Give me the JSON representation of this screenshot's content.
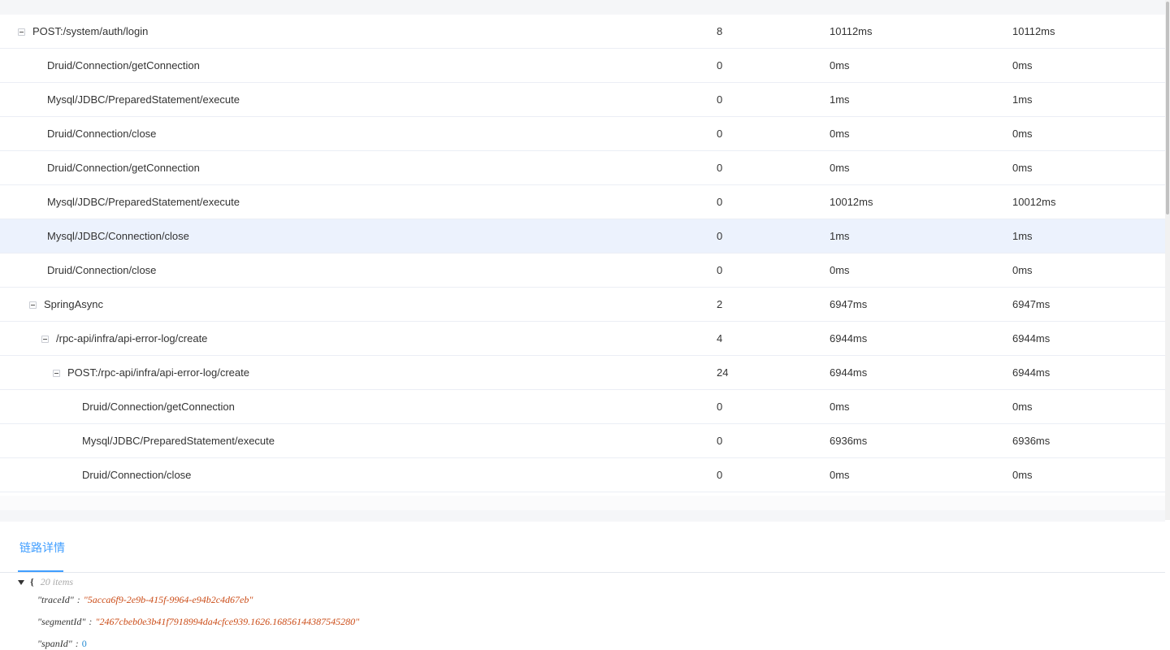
{
  "rows": [
    {
      "name": "POST:/system/auth/login",
      "count": "8",
      "duration": "10112ms",
      "self": "10112ms",
      "indent": 22,
      "toggle": true
    },
    {
      "name": "Druid/Connection/getConnection",
      "count": "0",
      "duration": "0ms",
      "self": "0ms",
      "indent": 58,
      "toggle": false
    },
    {
      "name": "Mysql/JDBC/PreparedStatement/execute",
      "count": "0",
      "duration": "1ms",
      "self": "1ms",
      "indent": 58,
      "toggle": false
    },
    {
      "name": "Druid/Connection/close",
      "count": "0",
      "duration": "0ms",
      "self": "0ms",
      "indent": 58,
      "toggle": false
    },
    {
      "name": "Druid/Connection/getConnection",
      "count": "0",
      "duration": "0ms",
      "self": "0ms",
      "indent": 58,
      "toggle": false
    },
    {
      "name": "Mysql/JDBC/PreparedStatement/execute",
      "count": "0",
      "duration": "10012ms",
      "self": "10012ms",
      "indent": 58,
      "toggle": false
    },
    {
      "name": "Mysql/JDBC/Connection/close",
      "count": "0",
      "duration": "1ms",
      "self": "1ms",
      "indent": 58,
      "toggle": false,
      "selected": true
    },
    {
      "name": "Druid/Connection/close",
      "count": "0",
      "duration": "0ms",
      "self": "0ms",
      "indent": 58,
      "toggle": false
    },
    {
      "name": "SpringAsync",
      "count": "2",
      "duration": "6947ms",
      "self": "6947ms",
      "indent": 36,
      "toggle": true
    },
    {
      "name": "/rpc-api/infra/api-error-log/create",
      "count": "4",
      "duration": "6944ms",
      "self": "6944ms",
      "indent": 51,
      "toggle": true
    },
    {
      "name": "POST:/rpc-api/infra/api-error-log/create",
      "count": "24",
      "duration": "6944ms",
      "self": "6944ms",
      "indent": 65,
      "toggle": true
    },
    {
      "name": "Druid/Connection/getConnection",
      "count": "0",
      "duration": "0ms",
      "self": "0ms",
      "indent": 101,
      "toggle": false
    },
    {
      "name": "Mysql/JDBC/PreparedStatement/execute",
      "count": "0",
      "duration": "6936ms",
      "self": "6936ms",
      "indent": 101,
      "toggle": false
    },
    {
      "name": "Druid/Connection/close",
      "count": "0",
      "duration": "0ms",
      "self": "0ms",
      "indent": 101,
      "toggle": false
    }
  ],
  "tab": {
    "label": "链路详情"
  },
  "json": {
    "open_brace": "{",
    "items_label": "20 items",
    "lines": [
      {
        "key": "\"traceId\"",
        "value": "\"5acca6f9-2e9b-415f-9964-e94b2c4d67eb\"",
        "type": "string"
      },
      {
        "key": "\"segmentId\"",
        "value": "\"2467cbeb0e3b41f7918994da4cfce939.1626.16856144387545280\"",
        "type": "string"
      },
      {
        "key": "\"spanId\"",
        "value": "0",
        "type": "number"
      }
    ]
  }
}
